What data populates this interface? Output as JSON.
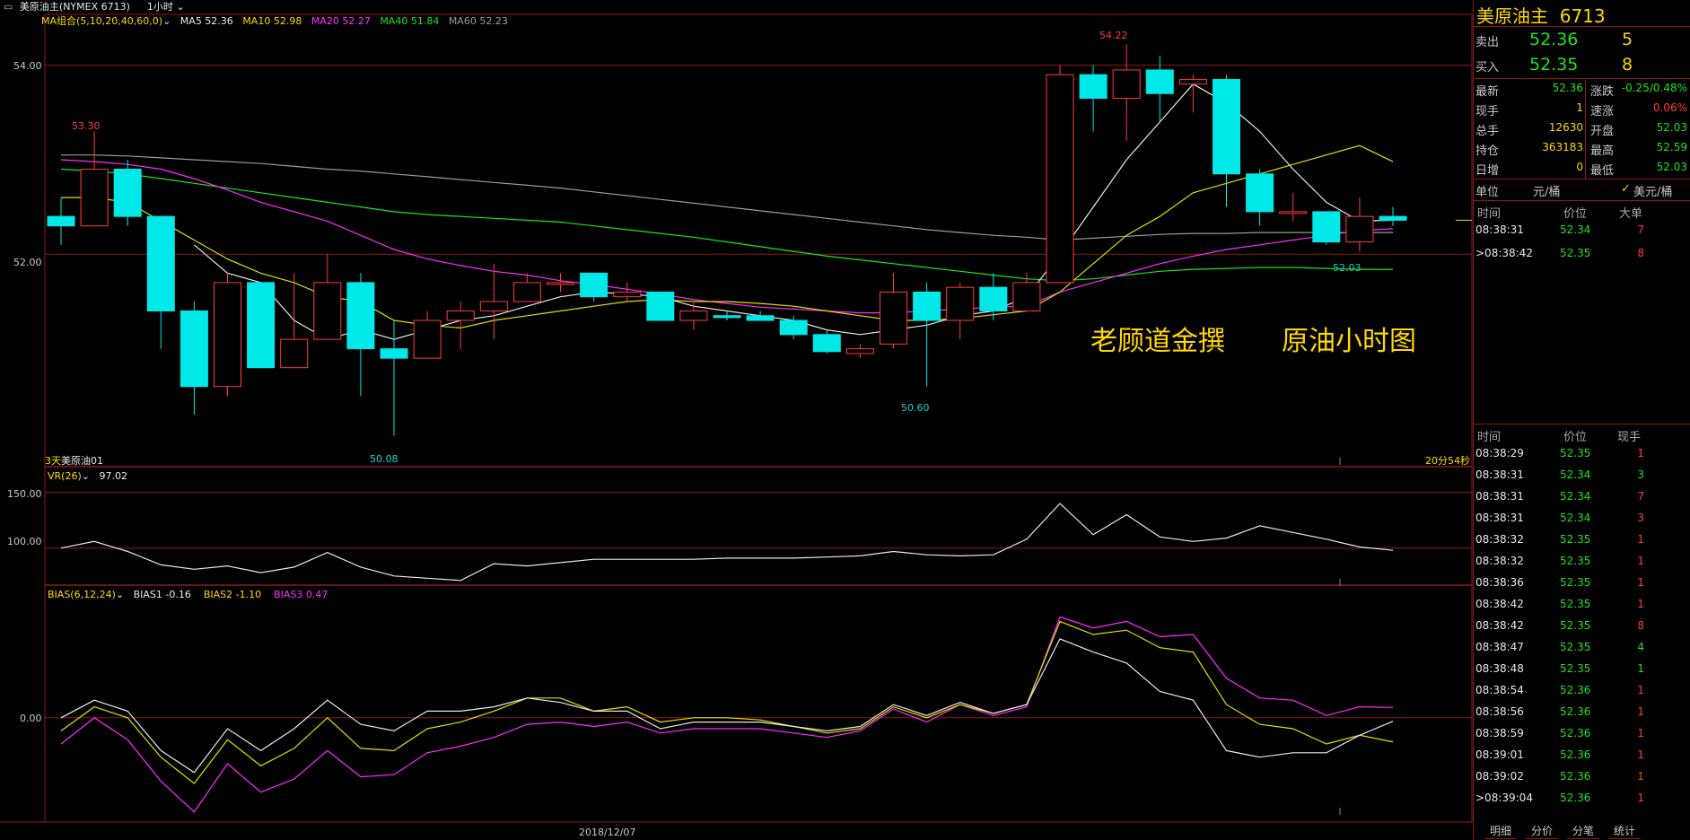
{
  "topbar": {
    "instrument": "美原油主(NYMEX 6713)",
    "period": "1小时"
  },
  "main_legend": {
    "combo": "MA组合(5,10,20,40,60,0)",
    "ma5": "MA5 52.36",
    "ma10": "MA10 52.98",
    "ma20": "MA20 52.27",
    "ma40": "MA40 51.84",
    "ma60": "MA60 52.23"
  },
  "colors": {
    "up": "#ff3b3b",
    "down": "#00e8e8",
    "ma5": "#e8e8e8",
    "ma10": "#e0e000",
    "ma20": "#ff2bff",
    "ma40": "#19e619",
    "ma60": "#9a9a9a",
    "grid": "#8a1a1a"
  },
  "main_ticks": [
    "54.00",
    "52.00"
  ],
  "price_annotations": {
    "high1": "53.30",
    "low1": "50.08",
    "low2": "50.60",
    "high2": "54.22",
    "low3": "52.03"
  },
  "bottom_left": "3天",
  "bottom_left2": "美原油01",
  "countdown": "20分54秒",
  "watermark1": "老顾道金撰",
  "watermark2": "原油小时图",
  "vr": {
    "label": "VR(26)",
    "value": "97.02",
    "ticks": [
      "150.00",
      "100.00"
    ]
  },
  "bias": {
    "label": "BIAS(6,12,24)",
    "b1": "BIAS1 -0.16",
    "b2": "BIAS2 -1.10",
    "b3": "BIAS3 0.47",
    "tick": "0.00"
  },
  "date_label": "2018/12/07",
  "chart_data": {
    "type": "candlestick",
    "ylim": [
      49.8,
      54.5
    ],
    "candles": [
      {
        "o": 52.4,
        "h": 52.6,
        "l": 52.1,
        "c": 52.3
      },
      {
        "o": 52.3,
        "h": 53.3,
        "l": 52.3,
        "c": 52.9
      },
      {
        "o": 52.9,
        "h": 53.0,
        "l": 52.3,
        "c": 52.4
      },
      {
        "o": 52.4,
        "h": 52.4,
        "l": 51.0,
        "c": 51.4
      },
      {
        "o": 51.4,
        "h": 51.5,
        "l": 50.3,
        "c": 50.6
      },
      {
        "o": 50.6,
        "h": 51.8,
        "l": 50.5,
        "c": 51.7
      },
      {
        "o": 51.7,
        "h": 51.7,
        "l": 50.8,
        "c": 50.8
      },
      {
        "o": 50.8,
        "h": 51.8,
        "l": 50.8,
        "c": 51.1
      },
      {
        "o": 51.1,
        "h": 52.0,
        "l": 51.1,
        "c": 51.7
      },
      {
        "o": 51.7,
        "h": 51.8,
        "l": 50.5,
        "c": 51.0
      },
      {
        "o": 51.0,
        "h": 51.3,
        "l": 50.08,
        "c": 50.9
      },
      {
        "o": 50.9,
        "h": 51.4,
        "l": 50.9,
        "c": 51.3
      },
      {
        "o": 51.3,
        "h": 51.5,
        "l": 51.0,
        "c": 51.4
      },
      {
        "o": 51.4,
        "h": 51.9,
        "l": 51.1,
        "c": 51.5
      },
      {
        "o": 51.5,
        "h": 51.8,
        "l": 51.5,
        "c": 51.7
      },
      {
        "o": 51.7,
        "h": 51.8,
        "l": 51.6,
        "c": 51.7
      },
      {
        "o": 51.8,
        "h": 51.8,
        "l": 51.5,
        "c": 51.55
      },
      {
        "o": 51.55,
        "h": 51.7,
        "l": 51.5,
        "c": 51.6
      },
      {
        "o": 51.6,
        "h": 51.6,
        "l": 51.3,
        "c": 51.3
      },
      {
        "o": 51.3,
        "h": 51.5,
        "l": 51.2,
        "c": 51.4
      },
      {
        "o": 51.35,
        "h": 51.4,
        "l": 51.3,
        "c": 51.33
      },
      {
        "o": 51.35,
        "h": 51.4,
        "l": 51.3,
        "c": 51.3
      },
      {
        "o": 51.3,
        "h": 51.35,
        "l": 51.1,
        "c": 51.15
      },
      {
        "o": 51.15,
        "h": 51.2,
        "l": 50.95,
        "c": 50.97
      },
      {
        "o": 50.95,
        "h": 51.05,
        "l": 50.9,
        "c": 51.0
      },
      {
        "o": 51.05,
        "h": 51.8,
        "l": 51.0,
        "c": 51.6
      },
      {
        "o": 51.6,
        "h": 51.7,
        "l": 50.6,
        "c": 51.3
      },
      {
        "o": 51.3,
        "h": 51.7,
        "l": 51.1,
        "c": 51.65
      },
      {
        "o": 51.65,
        "h": 51.8,
        "l": 51.3,
        "c": 51.4
      },
      {
        "o": 51.4,
        "h": 51.8,
        "l": 51.4,
        "c": 51.7
      },
      {
        "o": 51.7,
        "h": 54.0,
        "l": 51.7,
        "c": 53.9
      },
      {
        "o": 53.9,
        "h": 54.0,
        "l": 53.3,
        "c": 53.65
      },
      {
        "o": 53.65,
        "h": 54.22,
        "l": 53.2,
        "c": 53.95
      },
      {
        "o": 53.95,
        "h": 54.1,
        "l": 53.4,
        "c": 53.7
      },
      {
        "o": 53.8,
        "h": 53.9,
        "l": 53.5,
        "c": 53.85
      },
      {
        "o": 53.85,
        "h": 53.9,
        "l": 52.5,
        "c": 52.85
      },
      {
        "o": 52.85,
        "h": 52.9,
        "l": 52.3,
        "c": 52.45
      },
      {
        "o": 52.45,
        "h": 52.65,
        "l": 52.35,
        "c": 52.45
      },
      {
        "o": 52.45,
        "h": 52.45,
        "l": 52.1,
        "c": 52.13
      },
      {
        "o": 52.13,
        "h": 52.6,
        "l": 52.03,
        "c": 52.4
      },
      {
        "o": 52.4,
        "h": 52.5,
        "l": 52.3,
        "c": 52.36
      }
    ],
    "ma5": [
      null,
      null,
      null,
      null,
      52.1,
      51.8,
      51.7,
      51.3,
      51.1,
      51.2,
      51.1,
      51.2,
      51.3,
      51.35,
      51.45,
      51.55,
      51.6,
      51.58,
      51.55,
      51.45,
      51.4,
      51.35,
      51.3,
      51.2,
      51.15,
      51.2,
      51.25,
      51.35,
      51.4,
      51.55,
      52.0,
      52.5,
      53.0,
      53.4,
      53.8,
      53.6,
      53.3,
      52.9,
      52.55,
      52.35,
      52.36
    ],
    "ma10": [
      52.6,
      52.6,
      52.55,
      52.35,
      52.15,
      51.95,
      51.8,
      51.7,
      51.55,
      51.5,
      51.3,
      51.25,
      51.22,
      51.3,
      51.35,
      51.4,
      51.45,
      51.5,
      51.52,
      51.5,
      51.5,
      51.48,
      51.45,
      51.4,
      51.35,
      51.3,
      51.3,
      51.32,
      51.36,
      51.4,
      51.6,
      51.9,
      52.2,
      52.4,
      52.65,
      52.75,
      52.85,
      52.95,
      53.05,
      53.15,
      52.98
    ],
    "ma20": [
      53.0,
      52.98,
      52.95,
      52.9,
      52.8,
      52.68,
      52.55,
      52.45,
      52.35,
      52.2,
      52.05,
      51.95,
      51.88,
      51.82,
      51.78,
      51.72,
      51.68,
      51.63,
      51.58,
      51.52,
      51.48,
      51.44,
      51.42,
      51.4,
      51.38,
      51.38,
      51.4,
      51.42,
      51.44,
      51.45,
      51.6,
      51.7,
      51.8,
      51.9,
      51.98,
      52.05,
      52.1,
      52.15,
      52.2,
      52.25,
      52.27
    ],
    "ma40": [
      52.9,
      52.88,
      52.85,
      52.8,
      52.75,
      52.7,
      52.65,
      52.6,
      52.55,
      52.5,
      52.45,
      52.42,
      52.4,
      52.38,
      52.36,
      52.34,
      52.3,
      52.26,
      52.22,
      52.18,
      52.13,
      52.08,
      52.03,
      51.98,
      51.94,
      51.9,
      51.86,
      51.82,
      51.78,
      51.74,
      51.72,
      51.74,
      51.78,
      51.82,
      51.84,
      51.85,
      51.86,
      51.86,
      51.85,
      51.84,
      51.84
    ],
    "ma60": [
      53.05,
      53.05,
      53.04,
      53.02,
      53.0,
      52.98,
      52.96,
      52.93,
      52.9,
      52.88,
      52.85,
      52.82,
      52.79,
      52.76,
      52.73,
      52.7,
      52.66,
      52.62,
      52.58,
      52.54,
      52.5,
      52.46,
      52.42,
      52.38,
      52.34,
      52.3,
      52.26,
      52.23,
      52.2,
      52.18,
      52.15,
      52.17,
      52.19,
      52.21,
      52.22,
      52.22,
      52.23,
      52.23,
      52.23,
      52.23,
      52.23
    ],
    "vr": [
      100,
      106,
      97,
      85,
      81,
      84,
      78,
      83,
      96,
      83,
      75,
      73,
      71,
      86,
      84,
      87,
      90,
      90,
      90,
      90,
      91,
      91,
      91,
      92,
      93,
      97,
      94,
      93,
      94,
      108,
      140,
      112,
      130,
      110,
      106,
      109,
      120,
      114,
      108,
      101,
      98
    ],
    "vr_ylim": [
      70,
      165
    ],
    "bias1": [
      0.0,
      0.8,
      0.3,
      -1.5,
      -2.5,
      -0.5,
      -1.5,
      -0.5,
      0.8,
      -0.3,
      -0.6,
      0.3,
      0.3,
      0.5,
      0.9,
      0.7,
      0.3,
      0.3,
      -0.5,
      -0.2,
      -0.2,
      -0.2,
      -0.4,
      -0.6,
      -0.4,
      0.6,
      0.1,
      0.7,
      0.2,
      0.6,
      3.6,
      3.0,
      2.5,
      1.2,
      0.8,
      -1.5,
      -1.8,
      -1.6,
      -1.6,
      -0.8,
      -0.16
    ],
    "bias2": [
      -0.6,
      0.5,
      0.0,
      -1.8,
      -3.0,
      -1.0,
      -2.2,
      -1.4,
      0.0,
      -1.4,
      -1.5,
      -0.5,
      -0.2,
      0.3,
      0.9,
      0.9,
      0.3,
      0.5,
      -0.2,
      0.0,
      0.0,
      -0.1,
      -0.4,
      -0.7,
      -0.5,
      0.5,
      0.0,
      0.6,
      0.2,
      0.6,
      4.4,
      3.8,
      4.0,
      3.2,
      3.0,
      0.6,
      -0.3,
      -0.5,
      -1.2,
      -0.8,
      -1.1
    ],
    "bias3": [
      -1.2,
      0.0,
      -1.0,
      -2.9,
      -4.3,
      -2.1,
      -3.4,
      -2.8,
      -1.5,
      -2.7,
      -2.6,
      -1.6,
      -1.3,
      -0.9,
      -0.3,
      -0.2,
      -0.4,
      -0.2,
      -0.7,
      -0.5,
      -0.5,
      -0.5,
      -0.7,
      -0.9,
      -0.6,
      0.4,
      -0.2,
      0.6,
      0.1,
      0.5,
      4.6,
      4.1,
      4.4,
      3.7,
      3.8,
      1.8,
      0.9,
      0.8,
      0.1,
      0.5,
      0.47
    ],
    "bias_ylim": [
      -4.6,
      5.4
    ]
  },
  "panel": {
    "title": "美原油主",
    "code": "6713",
    "sell_label": "卖出",
    "sell_price": "52.36",
    "sell_qty": "5",
    "buy_label": "买入",
    "buy_price": "52.35",
    "buy_qty": "8",
    "stats": [
      {
        "l1": "最新",
        "v1": "52.36",
        "c1": "grn",
        "l2": "涨跌",
        "v2": "-0.25/0.48%",
        "c2": "grn"
      },
      {
        "l1": "现手",
        "v1": "1",
        "c1": "yel",
        "l2": "速涨",
        "v2": "0.06%",
        "c2": "red"
      },
      {
        "l1": "总手",
        "v1": "12630",
        "c1": "yel",
        "l2": "开盘",
        "v2": "52.03",
        "c2": "grn"
      },
      {
        "l1": "持仓",
        "v1": "363183",
        "c1": "yel",
        "l2": "最高",
        "v2": "52.59",
        "c2": "grn"
      },
      {
        "l1": "日增",
        "v1": "0",
        "c1": "yel",
        "l2": "最低",
        "v2": "52.03",
        "c2": "grn"
      }
    ],
    "unit_label": "单位",
    "unit_value": "元/桶",
    "unit_check": "美元/桶",
    "big_header": [
      "时间",
      "价位",
      "大单"
    ],
    "big_rows": [
      {
        "t": "08:38:31",
        "p": "52.34",
        "q": "7"
      },
      {
        "t": ">08:38:42",
        "p": "52.35",
        "q": "8"
      }
    ],
    "tick_header": [
      "时间",
      "价位",
      "现手"
    ],
    "tick_rows": [
      {
        "t": "08:38:29",
        "p": "52.35",
        "q": "1",
        "qc": "red"
      },
      {
        "t": "08:38:31",
        "p": "52.34",
        "q": "3",
        "qc": "grn"
      },
      {
        "t": "08:38:31",
        "p": "52.34",
        "q": "7",
        "qc": "red"
      },
      {
        "t": "08:38:31",
        "p": "52.34",
        "q": "3",
        "qc": "red"
      },
      {
        "t": "08:38:32",
        "p": "52.35",
        "q": "1",
        "qc": "red"
      },
      {
        "t": "08:38:32",
        "p": "52.35",
        "q": "1",
        "qc": "red"
      },
      {
        "t": "08:38:36",
        "p": "52.35",
        "q": "1",
        "qc": "red"
      },
      {
        "t": "08:38:42",
        "p": "52.35",
        "q": "1",
        "qc": "red"
      },
      {
        "t": "08:38:42",
        "p": "52.35",
        "q": "8",
        "qc": "red"
      },
      {
        "t": "08:38:47",
        "p": "52.35",
        "q": "4",
        "qc": "grn"
      },
      {
        "t": "08:38:48",
        "p": "52.35",
        "q": "1",
        "qc": "grn"
      },
      {
        "t": "08:38:54",
        "p": "52.36",
        "q": "1",
        "qc": "red"
      },
      {
        "t": "08:38:56",
        "p": "52.36",
        "q": "1",
        "qc": "red"
      },
      {
        "t": "08:38:59",
        "p": "52.36",
        "q": "1",
        "qc": "red"
      },
      {
        "t": "08:39:01",
        "p": "52.36",
        "q": "1",
        "qc": "red"
      },
      {
        "t": "08:39:02",
        "p": "52.36",
        "q": "1",
        "qc": "red"
      },
      {
        "t": ">08:39:04",
        "p": "52.36",
        "q": "1",
        "qc": "red"
      }
    ],
    "tabs": [
      "明细",
      "分价",
      "分笔",
      "统计"
    ]
  }
}
